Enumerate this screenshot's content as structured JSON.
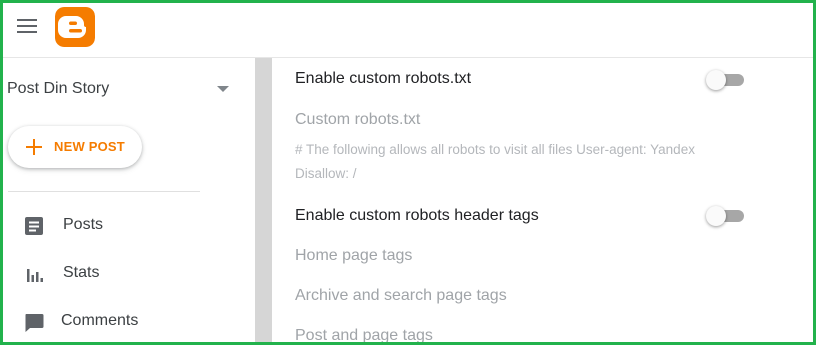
{
  "header": {
    "menu_icon": "hamburger-menu-icon",
    "logo_icon": "blogger-logo-icon",
    "logo_color": "#f57c00"
  },
  "sidebar": {
    "blog_name": "Post Din Story",
    "new_post_label": "NEW POST",
    "accent_color": "#f57c00",
    "items": [
      {
        "label": "Posts",
        "icon": "posts-icon"
      },
      {
        "label": "Stats",
        "icon": "stats-icon"
      },
      {
        "label": "Comments",
        "icon": "comments-icon"
      }
    ]
  },
  "settings": {
    "custom_robots_toggle_label": "Enable custom robots.txt",
    "custom_robots_toggle_on": false,
    "custom_robots_label": "Custom robots.txt",
    "custom_robots_value_line1": "# The following allows all robots to visit all files User-agent: Yandex",
    "custom_robots_value_line2": "Disallow: /",
    "robots_header_toggle_label": "Enable custom robots header tags",
    "robots_header_toggle_on": false,
    "home_page_tags": "Home page tags",
    "archive_tags": "Archive and search page tags",
    "post_page_tags": "Post and page tags"
  }
}
